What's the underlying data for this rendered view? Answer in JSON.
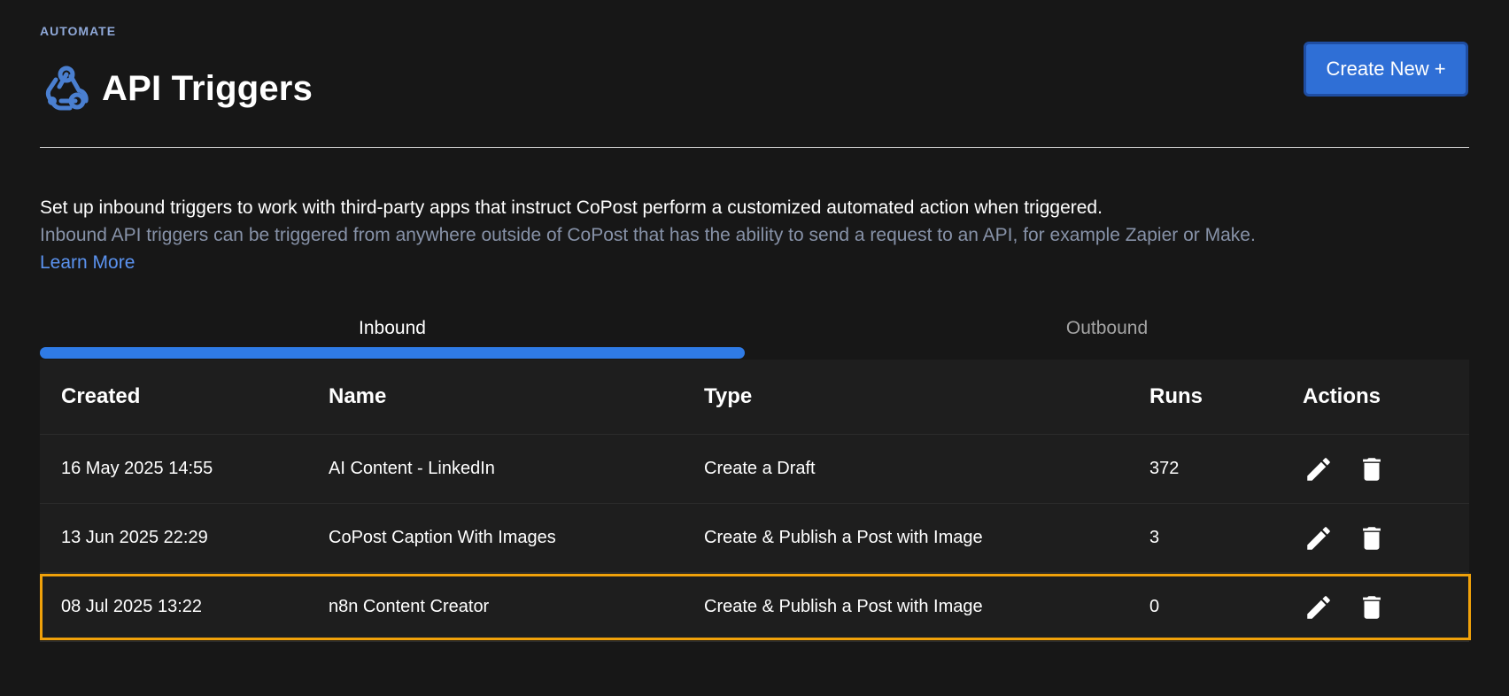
{
  "header": {
    "eyebrow": "AUTOMATE",
    "title": "API Triggers",
    "title_icon": "webhook-icon",
    "create_button_label": "Create New +"
  },
  "description": {
    "primary": "Set up inbound triggers to work with third-party apps that instruct CoPost perform a customized automated action when triggered.",
    "secondary": "Inbound API triggers can be triggered from anywhere outside of CoPost that has the ability to send a request to an API, for example Zapier or Make.",
    "learn_more": "Learn More"
  },
  "tabs": [
    {
      "label": "Inbound",
      "active": true
    },
    {
      "label": "Outbound",
      "active": false
    }
  ],
  "table": {
    "columns": [
      "Created",
      "Name",
      "Type",
      "Runs",
      "Actions"
    ],
    "rows": [
      {
        "created": "16 May 2025 14:55",
        "name": "AI Content - LinkedIn",
        "type": "Create a Draft",
        "runs": "372"
      },
      {
        "created": "13 Jun 2025 22:29",
        "name": "CoPost Caption With Images",
        "type": "Create & Publish a Post with Image",
        "runs": "3"
      },
      {
        "created": "08 Jul 2025 13:22",
        "name": "n8n Content Creator",
        "type": "Create & Publish a Post with Image",
        "runs": "0",
        "highlighted": true
      }
    ],
    "action_icons": [
      "edit-icon",
      "delete-icon"
    ]
  },
  "colors": {
    "background": "#171717",
    "accent": "#2f7be6",
    "button": "#2f6fd6",
    "link": "#5b93f0",
    "highlight_border": "#f0a10a",
    "muted_text": "#8792a8"
  }
}
